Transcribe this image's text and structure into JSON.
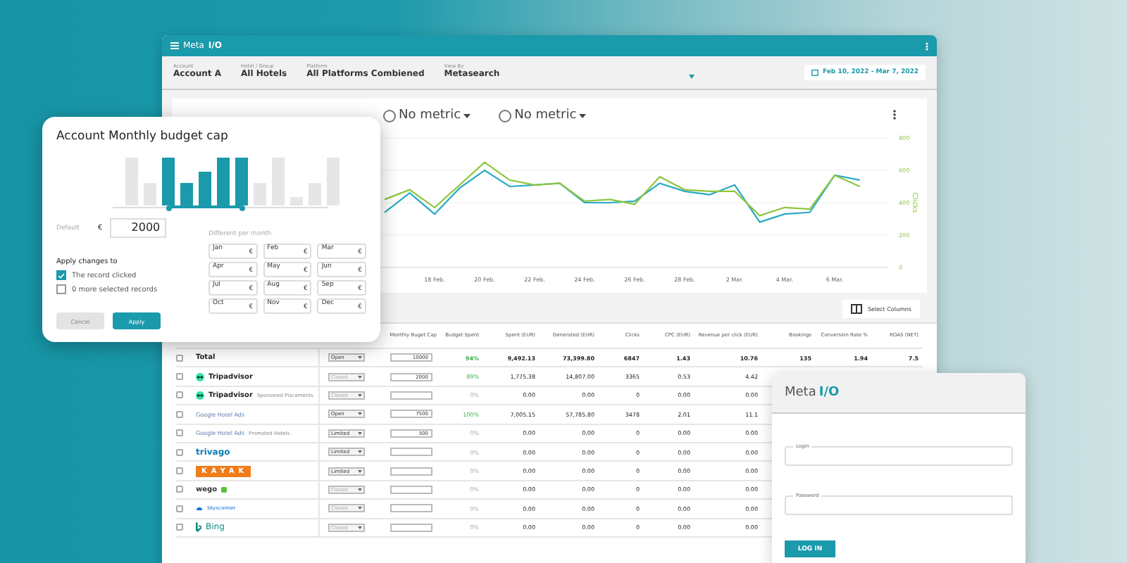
{
  "main_window": {
    "brand": "Meta",
    "brand_accent": "I/O",
    "filters": [
      {
        "label": "Account",
        "value": "Account A"
      },
      {
        "label": "Hotel / Group",
        "value": "All Hotels"
      },
      {
        "label": "Platform",
        "value": "All Platforms Combiened"
      },
      {
        "label": "View By",
        "value": "Metasearch"
      }
    ],
    "date_range": "Feb 10, 2022 - Mar 7, 2022",
    "chart": {
      "legend": [
        {
          "label": "No metric",
          "selected": false
        },
        {
          "label": "No metric",
          "selected": false
        }
      ],
      "chart_data": {
        "type": "line",
        "ylabel": "Clicks",
        "categories": [
          null,
          null,
          "18 Feb.",
          null,
          "20 Feb.",
          null,
          "22 Feb.",
          null,
          "24 Feb.",
          null,
          "26 Feb.",
          null,
          "28 Feb.",
          null,
          "2 Mar.",
          null,
          "4 Mar.",
          null,
          "6 Mar.",
          null
        ],
        "series": [
          {
            "color": "#2aa8c4",
            "values": [
              340,
              460,
              330,
              490,
              600,
              500,
              510,
              520,
              400,
              400,
              410,
              520,
              470,
              450,
              510,
              280,
              330,
              340,
              570,
              540
            ]
          },
          {
            "color": "#8dc63f",
            "values": [
              420,
              480,
              370,
              510,
              650,
              540,
              510,
              520,
              410,
              420,
              390,
              560,
              480,
              470,
              470,
              320,
              370,
              360,
              570,
              500
            ]
          }
        ],
        "ylim": [
          0,
          800
        ],
        "yticks": [
          0,
          200,
          400,
          600,
          800
        ],
        "grid": true
      }
    },
    "select_columns": "Select Columns",
    "table": {
      "columns": [
        "Monthly Buget Cap",
        "Budget Spent",
        "Spent (EUR)",
        "Generated (EUR)",
        "Clicks",
        "CPC (EUR)",
        "Revenue per click (EUR)",
        "Bookings",
        "Conversion Rate %",
        "ROAS (NET)"
      ],
      "rows": [
        {
          "kind": "total",
          "checked": false,
          "name": "Total",
          "status": {
            "value": "Open",
            "disabled": false
          },
          "budget_cap": "10000",
          "highlighted": true,
          "values": [
            "94%",
            "9,492.13",
            "73,399.80",
            "6847",
            "1.43",
            "10.76",
            "135",
            "1.94",
            "7.5"
          ]
        },
        {
          "kind": "tripadvisor",
          "checked": false,
          "name": "Tripadvisor",
          "status": {
            "value": "Closed",
            "disabled": true
          },
          "budget_cap": "2000",
          "highlighted": true,
          "values": [
            "89%",
            "1,775.38",
            "14,807.00",
            "3365",
            "0.53",
            "4.42"
          ]
        },
        {
          "kind": "tripadvisor",
          "checked": false,
          "name": "Tripadvisor",
          "sub": "Sponsored Placements",
          "status": {
            "value": "Closed",
            "disabled": true
          },
          "highlighted": false,
          "values": [
            "0%",
            "0.00",
            "0.00",
            "0",
            "0.00",
            "0.00"
          ]
        },
        {
          "kind": "google",
          "checked": false,
          "name": "Google Hotel Ads",
          "status": {
            "value": "Open",
            "disabled": false
          },
          "budget_cap": "7500",
          "highlighted": true,
          "values": [
            "100%",
            "7,005.15",
            "57,785.80",
            "3478",
            "2.01",
            "11.1"
          ]
        },
        {
          "kind": "google",
          "checked": false,
          "name": "Google Hotel Ads",
          "sub": "Promoted Hotels",
          "status": {
            "value": "Limited",
            "disabled": false
          },
          "budget_cap": "500",
          "highlighted": false,
          "values": [
            "0%",
            "0.00",
            "0.00",
            "0",
            "0.00",
            "0.00"
          ]
        },
        {
          "kind": "trivago",
          "checked": false,
          "name": "trivago",
          "status": {
            "value": "Limited",
            "disabled": false
          },
          "highlighted": false,
          "values": [
            "0%",
            "0.00",
            "0.00",
            "0",
            "0.00",
            "0.00"
          ]
        },
        {
          "kind": "kayak",
          "checked": false,
          "name": "KAYAK",
          "status": {
            "value": "Limited",
            "disabled": false
          },
          "highlighted": false,
          "values": [
            "0%",
            "0.00",
            "0.00",
            "0",
            "0.00",
            "0.00"
          ]
        },
        {
          "kind": "wego",
          "checked": false,
          "name": "wego",
          "status": {
            "value": "Closed",
            "disabled": true
          },
          "highlighted": false,
          "values": [
            "0%",
            "0.00",
            "0.00",
            "0",
            "0.00",
            "0.00"
          ]
        },
        {
          "kind": "skyscanner",
          "checked": false,
          "name": "Skyscanner",
          "status": {
            "value": "Closed",
            "disabled": true
          },
          "highlighted": false,
          "values": [
            "0%",
            "0.00",
            "0.00",
            "0",
            "0.00",
            "0.00"
          ]
        },
        {
          "kind": "bing",
          "checked": false,
          "name": "Bing",
          "status": {
            "value": "Closed",
            "disabled": true
          },
          "highlighted": false,
          "values": [
            "0%",
            "0.00",
            "0.00",
            "0",
            "0.00",
            "0.00"
          ]
        }
      ]
    }
  },
  "budget_dialog": {
    "title": "Account Monthly budget cap",
    "bars": [
      {
        "selected": false
      },
      {
        "selected": false
      },
      {
        "selected": true
      },
      {
        "selected": true
      },
      {
        "selected": true
      },
      {
        "selected": true
      },
      {
        "selected": true
      },
      {
        "selected": false
      },
      {
        "selected": false
      },
      {
        "selected": false
      },
      {
        "selected": false
      },
      {
        "selected": false
      }
    ],
    "default_label": "Default",
    "currency": "€",
    "default_value": "2000",
    "per_month_label": "Different per month",
    "months": [
      {
        "label": "Jan",
        "unit": "€"
      },
      {
        "label": "Feb",
        "unit": "€"
      },
      {
        "label": "Mar",
        "unit": "€"
      },
      {
        "label": "Apr",
        "unit": "€"
      },
      {
        "label": "May",
        "unit": "€"
      },
      {
        "label": "Jun",
        "unit": "€"
      },
      {
        "label": "Jul",
        "unit": "€"
      },
      {
        "label": "Aug",
        "unit": "€"
      },
      {
        "label": "Sep",
        "unit": "€"
      },
      {
        "label": "Oct",
        "unit": "€"
      },
      {
        "label": "Nov",
        "unit": "€"
      },
      {
        "label": "Dec",
        "unit": "€"
      }
    ],
    "apply_label": "Apply changes to",
    "options": [
      {
        "label": "The record clicked",
        "checked": true
      },
      {
        "label": "0 more selected records",
        "checked": false
      }
    ],
    "buttons": [
      "Cancel",
      "Apply"
    ]
  },
  "login_window": {
    "brand": "Meta",
    "brand_accent": "I/O",
    "fields": [
      {
        "label": "Login"
      },
      {
        "label": "Password"
      }
    ],
    "button": "LOG IN"
  }
}
